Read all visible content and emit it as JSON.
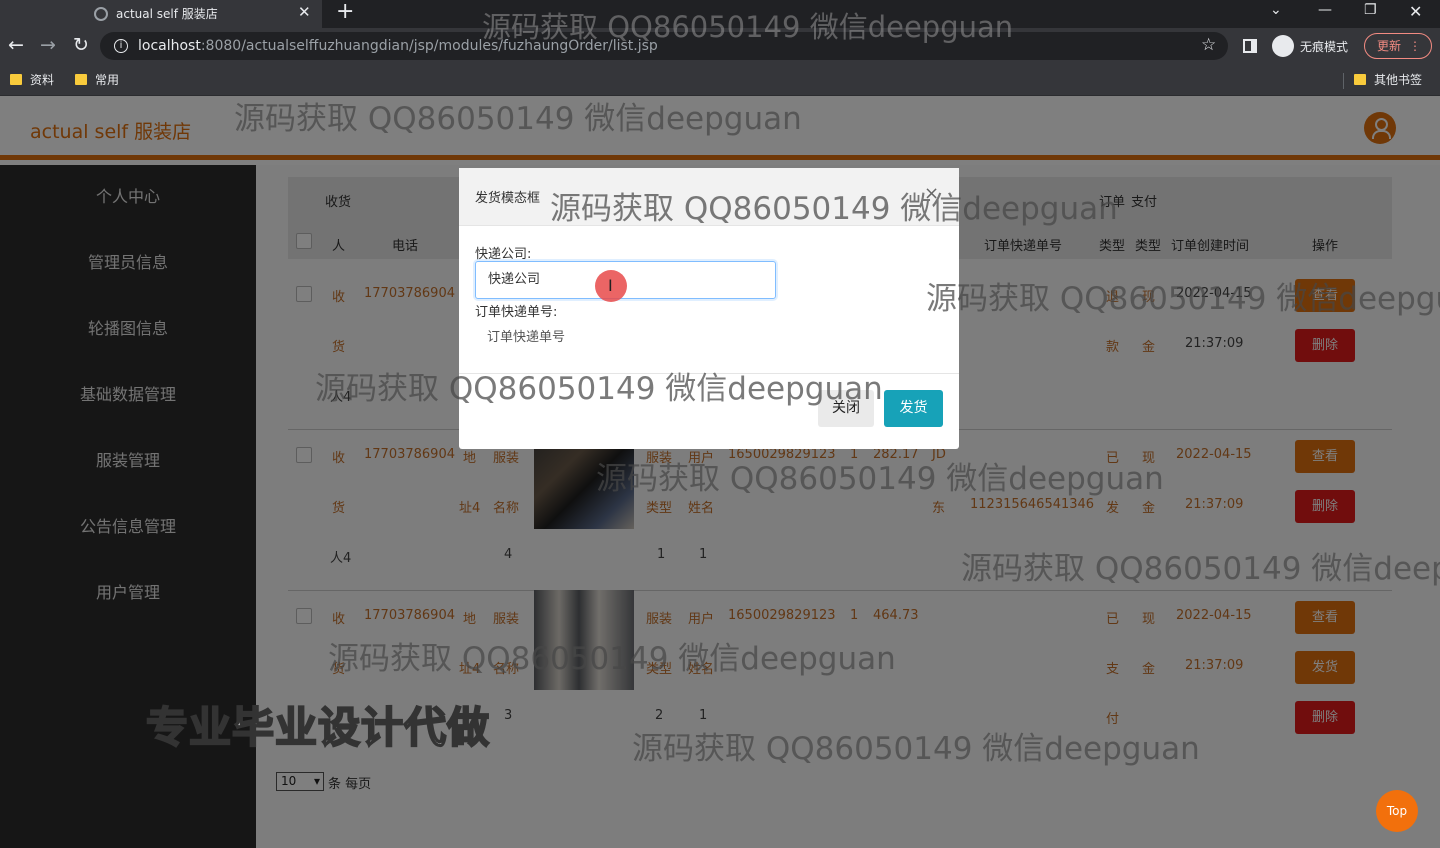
{
  "browser": {
    "tab_title": "actual self 服装店",
    "tab_close": "✕",
    "new_tab": "+",
    "url_host": "localhost",
    "url_rest": ":8080/actualselffuzhuangdian/jsp/modules/fuzhaungOrder/list.jsp",
    "incognito_label": "无痕模式",
    "update_label": "更新",
    "bookmarks": [
      "资料",
      "常用"
    ],
    "other_bookmarks": "其他书签"
  },
  "header": {
    "logo": "actual self 服装店"
  },
  "sidebar": {
    "items": [
      "个人中心",
      "管理员信息",
      "轮播图信息",
      "基础数据管理",
      "服装管理",
      "公告信息管理",
      "用户管理"
    ]
  },
  "table": {
    "headers": {
      "receiver_1": "收货",
      "receiver_2": "人",
      "phone": "电话",
      "order_1": "订单",
      "pay_1": "支付",
      "express_no": "订单快递单号",
      "order_2": "类型",
      "pay_2": "类型",
      "created": "订单创建时间",
      "ops": "操作"
    },
    "row1": {
      "receiver": [
        "收",
        "货",
        "人4"
      ],
      "phone": "17703786904",
      "status": [
        "退",
        "款"
      ],
      "pay": [
        "现",
        "金"
      ],
      "date": "2022-04-15",
      "time": "21:37:09"
    },
    "row2": {
      "receiver": [
        "收",
        "货",
        "人4"
      ],
      "phone": "17703786904",
      "addr": [
        "地",
        "址4"
      ],
      "goods": [
        "服装",
        "名称"
      ],
      "goods_no": "4",
      "type": [
        "服装",
        "类型"
      ],
      "user": [
        "用户",
        "姓名"
      ],
      "order_no": "1650029829123",
      "buy_count": "1",
      "user_no": "1",
      "price": "282.17",
      "express_co": "JD",
      "express_co_2": "东",
      "express_no": "112315646541346",
      "status": [
        "已",
        "发"
      ],
      "pay": [
        "现",
        "金"
      ],
      "date": "2022-04-15",
      "time": "21:37:09"
    },
    "row3": {
      "receiver": [
        "收",
        "货"
      ],
      "phone": "17703786904",
      "addr": [
        "地",
        "址4"
      ],
      "goods": [
        "服装",
        "名称"
      ],
      "goods_no": "3",
      "type": [
        "服装",
        "类型"
      ],
      "user": [
        "用户",
        "姓名"
      ],
      "order_no": "1650029829123",
      "buy_count": "1",
      "user_no": "2",
      "user_no_2": "1",
      "price": "464.73",
      "status": [
        "已",
        "支",
        "付"
      ],
      "pay": [
        "现",
        "金"
      ],
      "date": "2022-04-15",
      "time": "21:37:09"
    },
    "buttons": {
      "view": "查看",
      "delete": "删除",
      "ship": "发货"
    }
  },
  "pager": {
    "page_size": "10",
    "per_page_label": "条 每页"
  },
  "top_button": "Top",
  "modal": {
    "title": "发货模态框",
    "close_x": "×",
    "company_label": "快递公司:",
    "company_placeholder": "快递公司",
    "express_label": "订单快递单号:",
    "express_placeholder": "订单快递单号",
    "close_label": "关闭",
    "ship_label": "发货"
  },
  "watermarks": {
    "text": "源码获取 QQ86050149 微信deepguan",
    "big": "专业毕业设计代做"
  },
  "colors": {
    "accent": "#e0700f",
    "danger": "#e21a1a",
    "info": "#17a2b8",
    "sidebar": "#2d2d2d"
  }
}
